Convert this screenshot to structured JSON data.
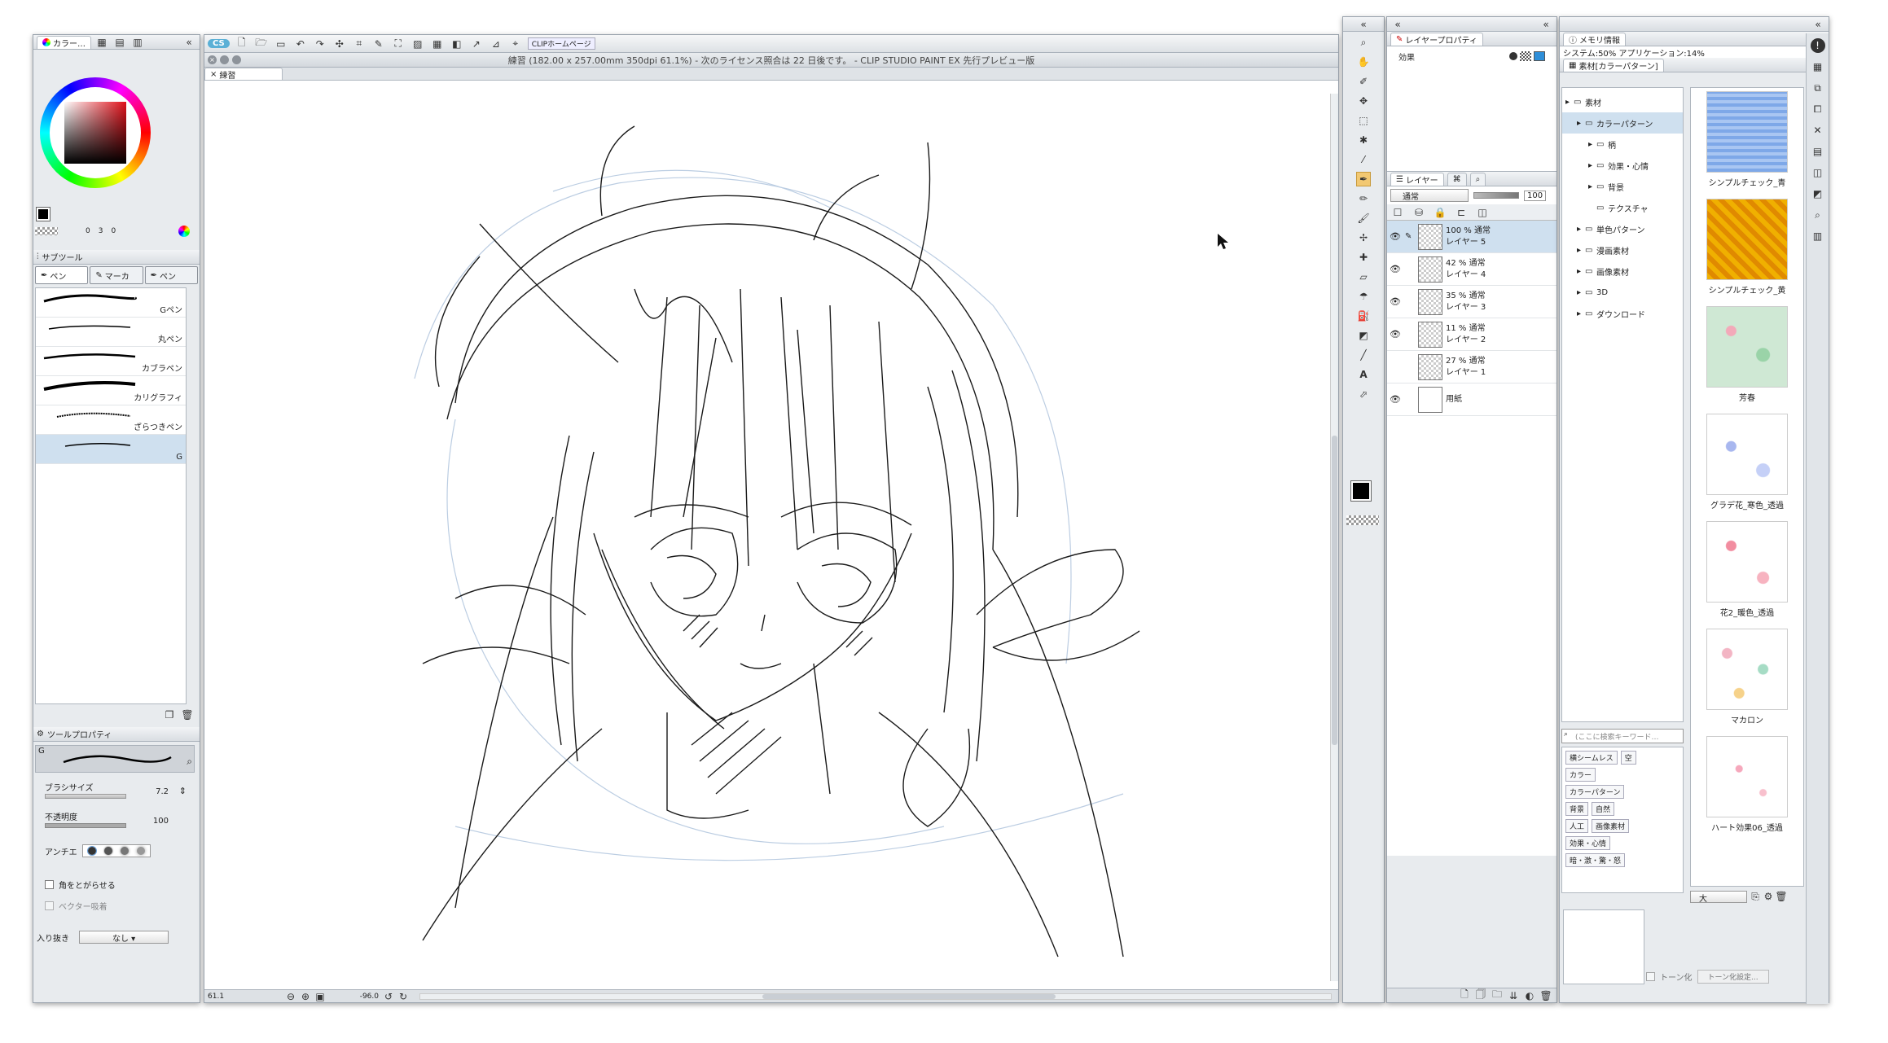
{
  "left_top": {
    "tabs": [
      "カラー…"
    ],
    "small_readout": [
      "0",
      "3",
      "0"
    ]
  },
  "subtool": {
    "title": "サブツール",
    "tabs": [
      "ペン",
      "マーカ",
      "ペン"
    ],
    "items": [
      "Gペン",
      "丸ペン",
      "カブラペン",
      "カリグラフィ",
      "ざらつきペン",
      "G"
    ]
  },
  "toolprop": {
    "title": "ツールプロパティ",
    "preset": "G",
    "brush_size_label": "ブラシサイズ",
    "brush_size": "7.2",
    "opacity_label": "不透明度",
    "opacity": "100",
    "antialias_label": "アンチエ",
    "sharpen_label": "角をとがらせる",
    "vector_label": "ベクター吸着",
    "inout_label": "入り抜き",
    "inout_value": "なし"
  },
  "canvas": {
    "home_button": "CLIPホームページ",
    "title": "練習 (182.00 x 257.00mm 350dpi 61.1%)  - 次のライセンス照合は 22 日後です。 - CLIP STUDIO PAINT EX 先行プレビュー版",
    "doc_tab": "練習",
    "zoom": "61.1",
    "rotation": "-96.0"
  },
  "layerprop": {
    "title": "レイヤープロパティ",
    "effect_label": "効果"
  },
  "layers": {
    "tabs": [
      "レイヤー"
    ],
    "blend_mode": "通常",
    "opacity": "100",
    "items": [
      {
        "pct": "100 % 通常",
        "name": "レイヤー 5",
        "visible": true
      },
      {
        "pct": "42 % 通常",
        "name": "レイヤー 4",
        "visible": true
      },
      {
        "pct": "35 % 通常",
        "name": "レイヤー 3",
        "visible": true
      },
      {
        "pct": "11 % 通常",
        "name": "レイヤー 2",
        "visible": true
      },
      {
        "pct": "27 % 通常",
        "name": "レイヤー 1",
        "visible": false
      },
      {
        "pct": "",
        "name": "用紙",
        "visible": true
      }
    ]
  },
  "memory": {
    "tab": "メモリ情報",
    "text": "システム:50% アプリケーション:14%"
  },
  "material": {
    "tab": "素材[カラーパターン]",
    "tree": [
      {
        "label": "素材",
        "indent": 0,
        "sel": false
      },
      {
        "label": "カラーパターン",
        "indent": 1,
        "sel": true
      },
      {
        "label": "柄",
        "indent": 2,
        "sel": false
      },
      {
        "label": "効果・心情",
        "indent": 2,
        "sel": false
      },
      {
        "label": "背景",
        "indent": 2,
        "sel": false
      },
      {
        "label": "テクスチャ",
        "indent": 2,
        "sel": false
      },
      {
        "label": "単色パターン",
        "indent": 1,
        "sel": false
      },
      {
        "label": "漫画素材",
        "indent": 1,
        "sel": false
      },
      {
        "label": "画像素材",
        "indent": 1,
        "sel": false
      },
      {
        "label": "3D",
        "indent": 1,
        "sel": false
      },
      {
        "label": "ダウンロード",
        "indent": 1,
        "sel": false
      }
    ],
    "search_placeholder": "(ここに検索キーワード…",
    "tags": [
      [
        "横シームレス",
        "空"
      ],
      [
        "カラー"
      ],
      [
        "カラーパターン"
      ],
      [
        "背景",
        "自然"
      ],
      [
        "人工",
        "画像素材"
      ],
      [
        "効果・心情"
      ],
      [
        "暗・激・驚・怒"
      ]
    ],
    "thumbs": [
      "シンプルチェック_青",
      "シンプルチェック_黄",
      "芳春",
      "グラデ花_寒色_透過",
      "花2_暖色_透過",
      "マカロン",
      "ハート効果06_透過"
    ],
    "size": "大",
    "tone_label": "トーン化",
    "tone_button": "トーン化設定..."
  }
}
